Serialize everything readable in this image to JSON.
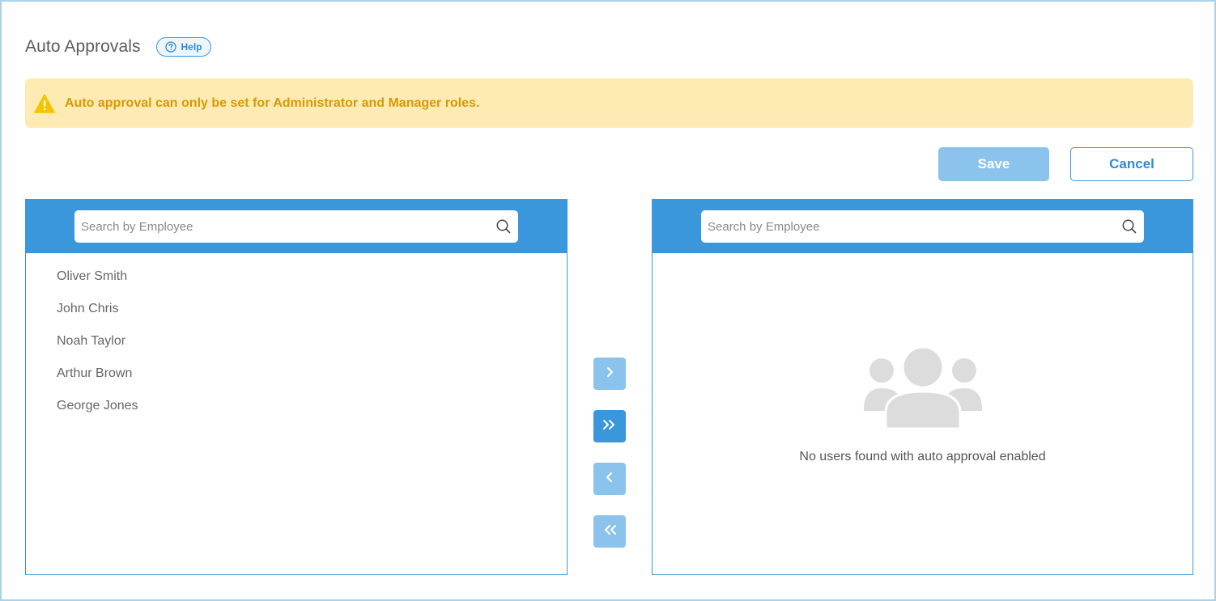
{
  "header": {
    "title": "Auto Approvals",
    "help_label": "Help"
  },
  "alert": {
    "message": "Auto approval can only be set for Administrator and Manager roles."
  },
  "actions": {
    "save_label": "Save",
    "cancel_label": "Cancel"
  },
  "left_panel": {
    "search_placeholder": "Search by Employee",
    "employees": [
      "Oliver Smith",
      "John Chris",
      "Noah Taylor",
      "Arthur Brown",
      "George Jones"
    ]
  },
  "right_panel": {
    "search_placeholder": "Search by Employee",
    "empty_message": "No users found with auto approval enabled"
  },
  "colors": {
    "accent": "#3a97dc",
    "accent_light": "#8cc3ec",
    "alert_bg": "#feebb3",
    "alert_text": "#d99a00",
    "warning_icon": "#f5c400"
  }
}
